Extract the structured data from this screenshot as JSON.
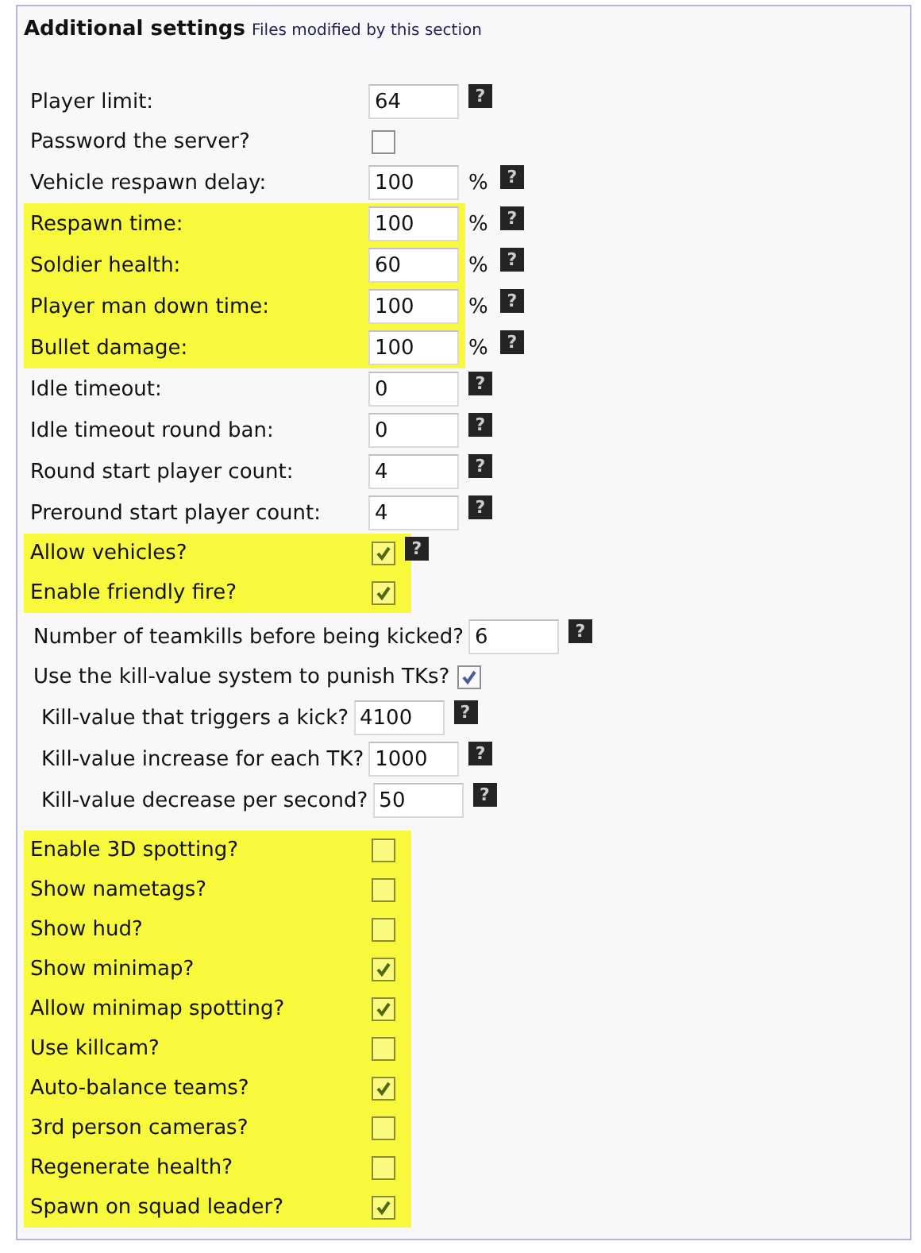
{
  "title": "Additional settings",
  "subtitle": "Files modified by this section",
  "blocks": [
    {
      "kind": "main",
      "highlighted": false,
      "rows": [
        {
          "kind": "input",
          "label": "Player limit:",
          "value": "64",
          "help": "?"
        },
        {
          "kind": "checkbox",
          "label": "Password the server?",
          "checked": false
        },
        {
          "kind": "input",
          "label": "Vehicle respawn delay:",
          "value": "100",
          "unit": "%",
          "help": "?"
        }
      ]
    },
    {
      "kind": "main",
      "highlighted": true,
      "rows": [
        {
          "kind": "input",
          "label": "Respawn time:",
          "value": "100",
          "unit": "%",
          "help": "?"
        },
        {
          "kind": "input",
          "label": "Soldier health:",
          "value": "60",
          "unit": "%",
          "help": "?"
        },
        {
          "kind": "input",
          "label": "Player man down time:",
          "value": "100",
          "unit": "%",
          "help": "?"
        },
        {
          "kind": "input",
          "label": "Bullet damage:",
          "value": "100",
          "unit": "%",
          "help": "?"
        }
      ]
    },
    {
      "kind": "main",
      "highlighted": false,
      "rows": [
        {
          "kind": "input",
          "label": "Idle timeout:",
          "value": "0",
          "help": "?"
        },
        {
          "kind": "input",
          "label": "Idle timeout round ban:",
          "value": "0",
          "help": "?"
        },
        {
          "kind": "input",
          "label": "Round start player count:",
          "value": "4",
          "help": "?"
        },
        {
          "kind": "input",
          "label": "Preround start player count:",
          "value": "4",
          "help": "?"
        }
      ]
    },
    {
      "kind": "main",
      "highlighted": true,
      "rows": [
        {
          "kind": "checkbox",
          "label": "Allow vehicles?",
          "checked": true,
          "help": "?"
        },
        {
          "kind": "checkbox",
          "label": "Enable friendly fire?",
          "checked": true
        }
      ]
    },
    {
      "kind": "teamkill",
      "highlighted": false,
      "rows": [
        {
          "kind": "input",
          "label": "Number of teamkills before being kicked?",
          "value": "6",
          "help": "?"
        },
        {
          "kind": "checkbox",
          "label": "Use the kill-value system to punish TKs?",
          "checked": true,
          "children": [
            {
              "kind": "input",
              "label": "Kill-value that triggers a kick?",
              "value": "4100",
              "help": "?"
            },
            {
              "kind": "input",
              "label": "Kill-value increase for each TK?",
              "value": "1000",
              "help": "?"
            },
            {
              "kind": "input",
              "label": "Kill-value decrease per second?",
              "value": "50",
              "help": "?"
            }
          ]
        }
      ]
    },
    {
      "kind": "main",
      "highlighted": true,
      "rows": [
        {
          "kind": "checkbox",
          "label": "Enable 3D spotting?",
          "checked": false
        },
        {
          "kind": "checkbox",
          "label": "Show nametags?",
          "checked": false
        },
        {
          "kind": "checkbox",
          "label": "Show hud?",
          "checked": false
        },
        {
          "kind": "checkbox",
          "label": "Show minimap?",
          "checked": true
        },
        {
          "kind": "checkbox",
          "label": "Allow minimap spotting?",
          "checked": true
        },
        {
          "kind": "checkbox",
          "label": "Use killcam?",
          "checked": false
        },
        {
          "kind": "checkbox",
          "label": "Auto-balance teams?",
          "checked": true
        },
        {
          "kind": "checkbox",
          "label": "3rd person cameras?",
          "checked": false
        },
        {
          "kind": "checkbox",
          "label": "Regenerate health?",
          "checked": false
        },
        {
          "kind": "checkbox",
          "label": "Spawn on squad leader?",
          "checked": true
        }
      ]
    }
  ]
}
